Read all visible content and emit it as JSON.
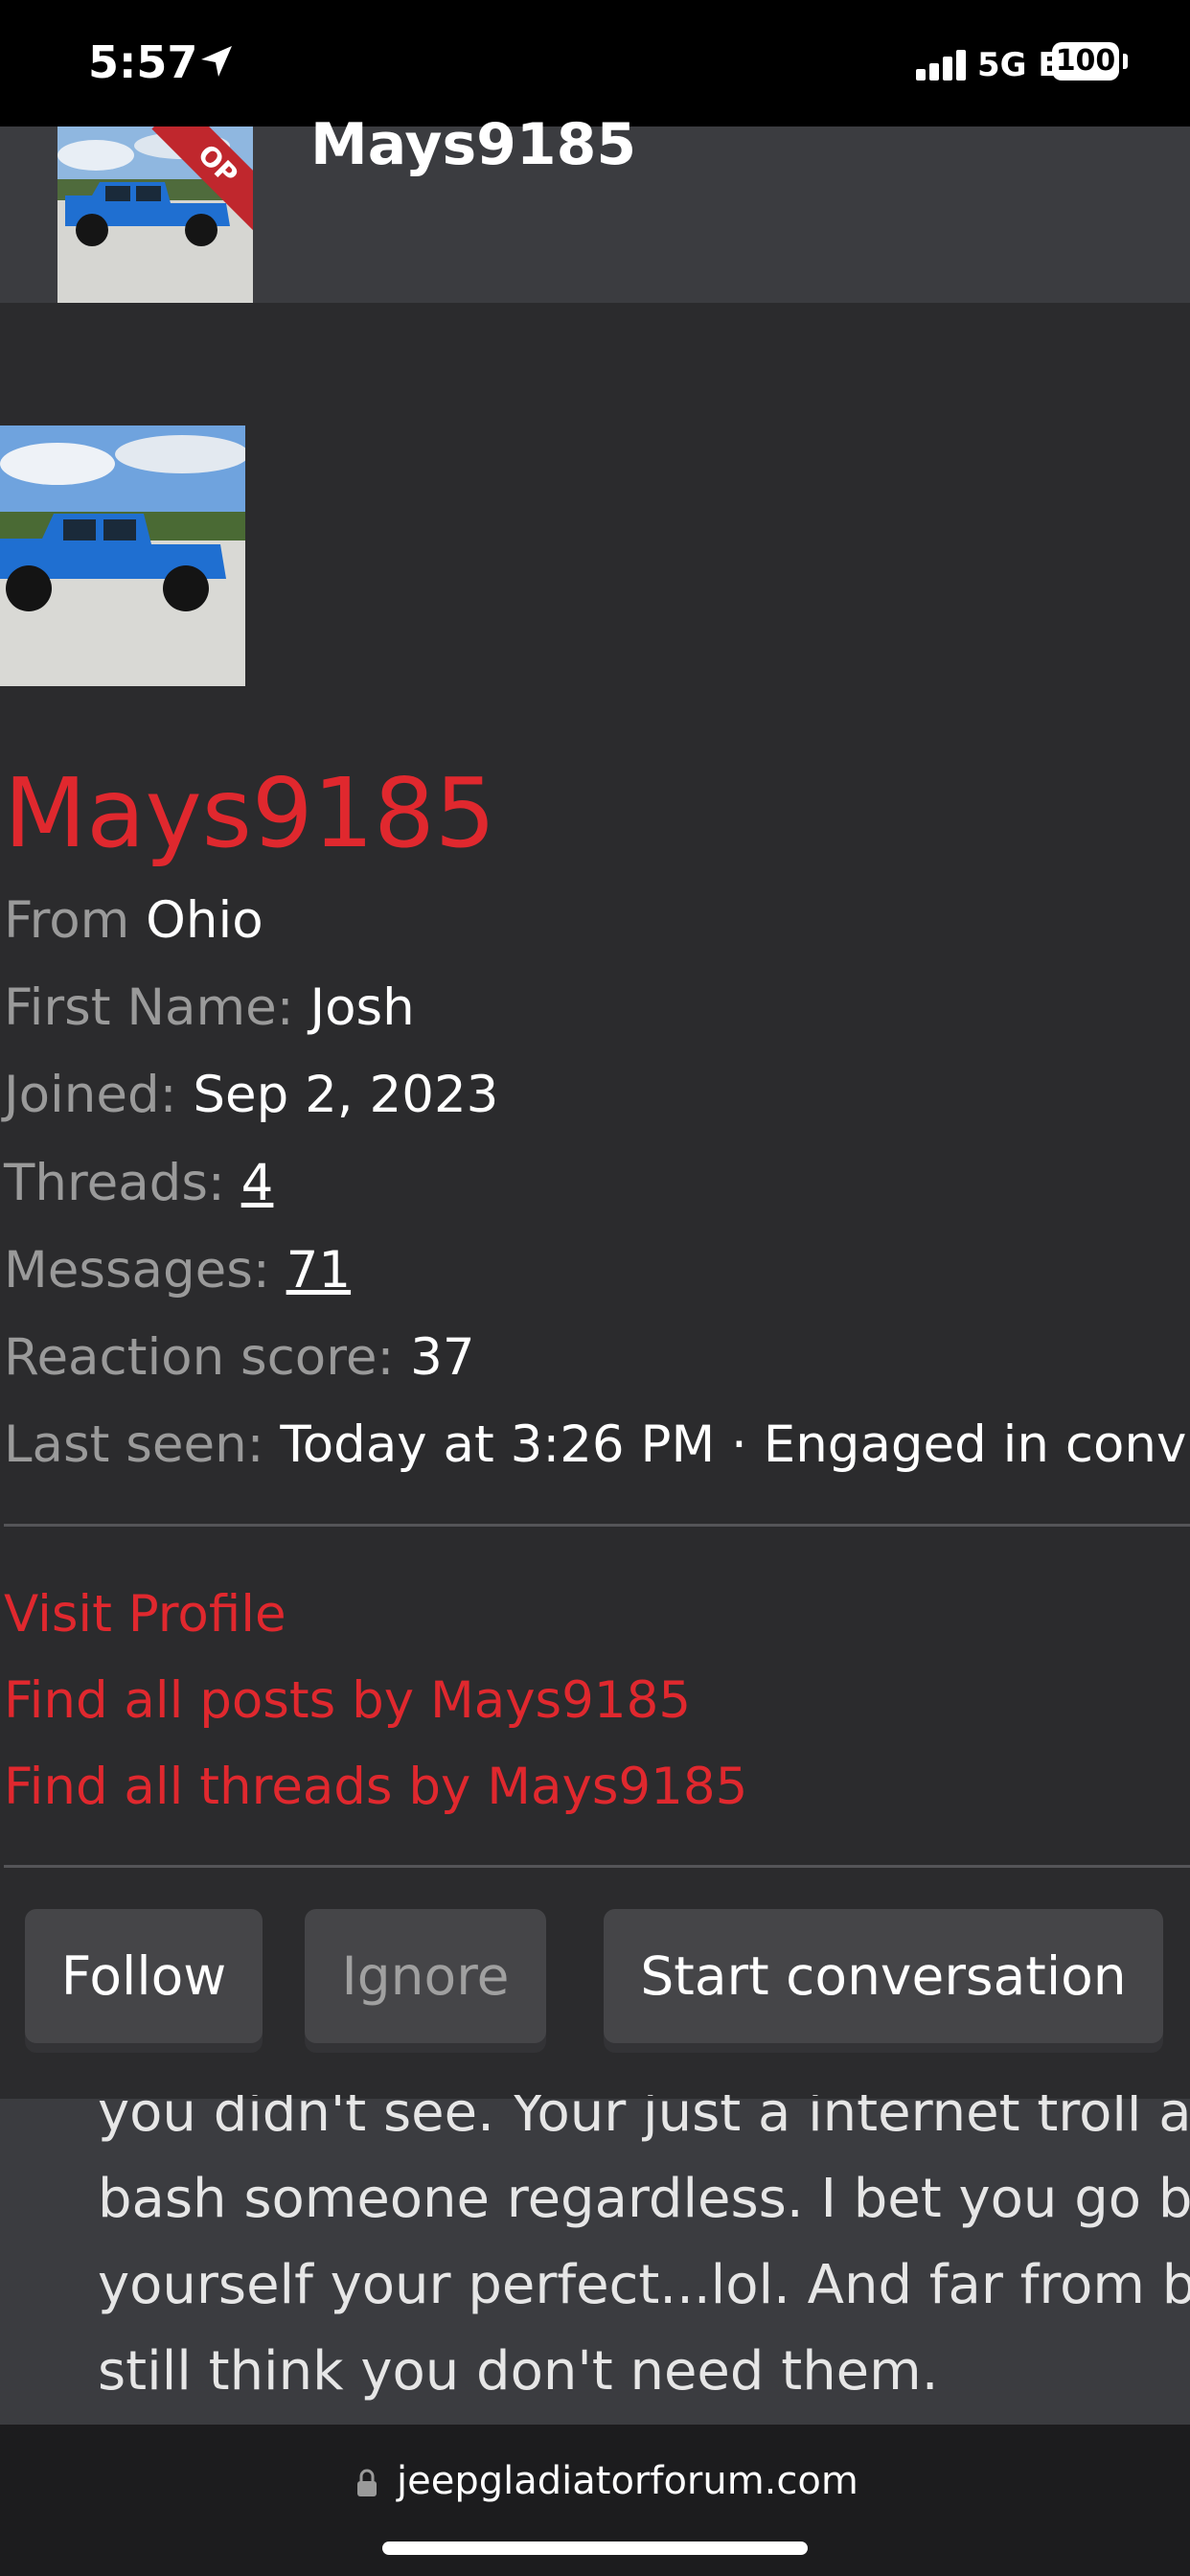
{
  "status_bar": {
    "time": "5:57",
    "network": "5G E",
    "battery": "100"
  },
  "post_header": {
    "username": "Mays9185",
    "badge": "OP"
  },
  "profile_card": {
    "username": "Mays9185",
    "location_label": "From",
    "location_value": "Ohio",
    "first_name_label": "First Name:",
    "first_name_value": "Josh",
    "joined_label": "Joined:",
    "joined_value": "Sep 2, 2023",
    "threads_label": "Threads:",
    "threads_value": "4",
    "messages_label": "Messages:",
    "messages_value": "71",
    "reaction_label": "Reaction score:",
    "reaction_value": "37",
    "last_seen_label": "Last seen:",
    "last_seen_value": "Today at 3:26 PM · Engaged in conv",
    "links": {
      "visit_profile": "Visit Profile",
      "find_posts": "Find all posts by Mays9185",
      "find_threads": "Find all threads by Mays9185"
    },
    "buttons": {
      "follow": "Follow",
      "ignore": "Ignore",
      "start_conversation": "Start conversation"
    }
  },
  "background_post": {
    "lines": [
      "you didn't see. Your just a internet troll a",
      "bash someone regardless. I bet you go b",
      "yourself your perfect...lol. And far from b",
      "still think you don't need them."
    ]
  },
  "browser": {
    "url": "jeepgladiatorforum.com"
  },
  "colors": {
    "accent_red": "#e0282e",
    "card_background": "#2b2b2d",
    "header_background": "#3b3c40",
    "jeep_blue": "#1f6fd1"
  }
}
